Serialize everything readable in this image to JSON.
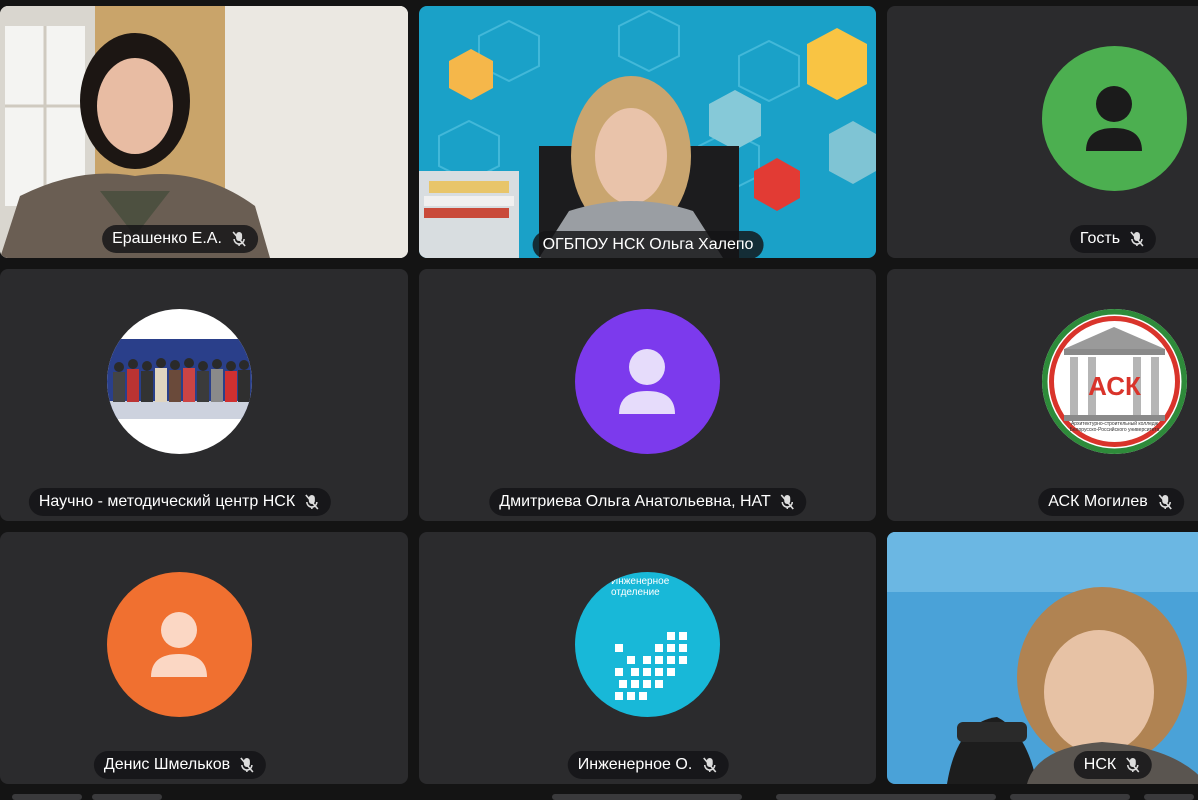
{
  "participants": [
    {
      "name": "Ерашенко Е.А.",
      "kind": "video",
      "muted": true
    },
    {
      "name": "ОГБПОУ НСК Ольга Халепо",
      "kind": "video",
      "muted": false
    },
    {
      "name": "Гость",
      "kind": "avatar",
      "avatar_color": "#4caf50",
      "muted": true
    },
    {
      "name": "Научно - методический центр НСК",
      "kind": "photo-avatar",
      "muted": true
    },
    {
      "name": "Дмитриева Ольга Анатольевна, НАТ",
      "kind": "avatar",
      "avatar_color": "#7c3aed",
      "muted": true
    },
    {
      "name": "АСК Могилев",
      "kind": "logo-avatar",
      "logo_text": "АСК",
      "logo_caption": "Архитектурно-строительный колледж",
      "logo_caption2": "Белорусско-Российского университета",
      "muted": true
    },
    {
      "name": "Денис Шмельков",
      "kind": "avatar",
      "avatar_color": "#f07030",
      "muted": true
    },
    {
      "name": "Инженерное О.",
      "kind": "logo-avatar",
      "logo_text": "Инженерное\nотделение",
      "avatar_color": "#18b8d8",
      "muted": true
    },
    {
      "name": "НСК",
      "kind": "video",
      "muted": true
    }
  ],
  "icons": {
    "mic_muted": "mic-off-icon",
    "person": "person-icon"
  },
  "colors": {
    "tile_bg": "#2b2b2d",
    "label_bg": "#141416",
    "page_bg": "#141414"
  }
}
